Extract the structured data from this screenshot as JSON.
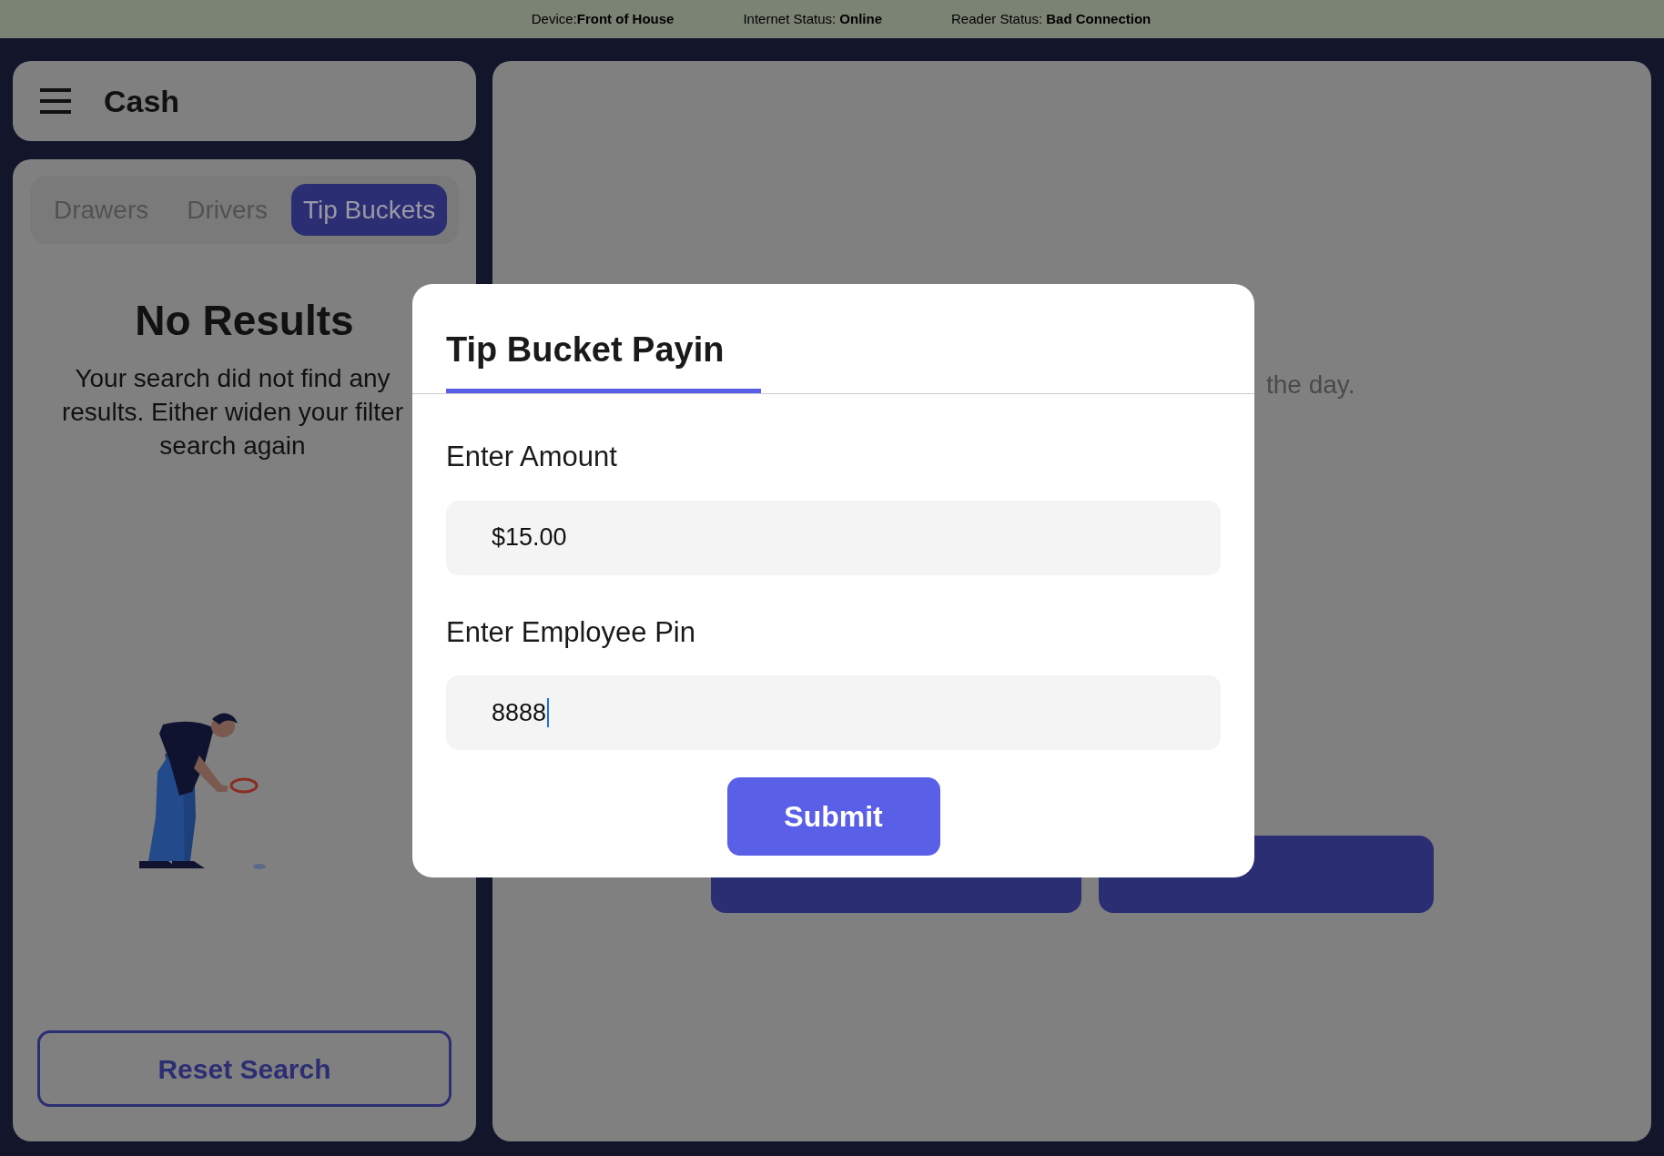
{
  "status_bar": {
    "items": [
      "Device:**Front of House**",
      "Internet Status: **Online**",
      "Reader Status: **Bad Connection**"
    ]
  },
  "header": {
    "title": "Cash"
  },
  "tabs": [
    {
      "label": "Drawers",
      "selected": false
    },
    {
      "label": "Drivers",
      "selected": false
    },
    {
      "label": "Tip Buckets",
      "selected": true
    }
  ],
  "empty_state": {
    "title": "No Results",
    "lines": [
      "Your search did not find any",
      "results. Either widen your filter",
      "search again"
    ]
  },
  "reset_button": "Reset Search",
  "main_panel": {
    "subtitle": "the day."
  },
  "dialog": {
    "title": "Tip Bucket Payin",
    "fields": [
      {
        "label": "Enter Amount",
        "value": "$15.00",
        "focused": false
      },
      {
        "label": "Enter Employee Pin",
        "value": "8888",
        "focused": true
      }
    ],
    "submit": "Submit"
  }
}
